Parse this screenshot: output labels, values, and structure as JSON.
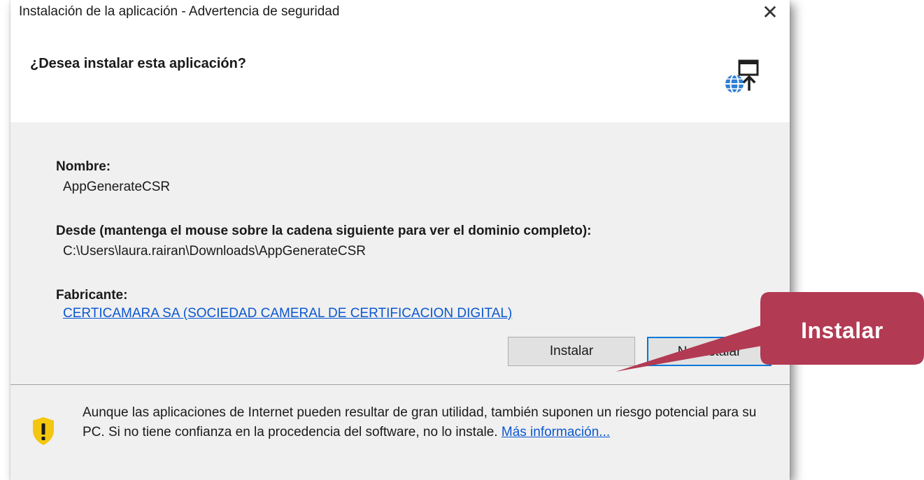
{
  "window": {
    "title": "Instalación de la aplicación - Advertencia de seguridad",
    "close_glyph": "✕"
  },
  "header": {
    "question": "¿Desea instalar esta aplicación?",
    "icon": "web-app-install-icon"
  },
  "fields": {
    "name_label": "Nombre:",
    "name_value": "AppGenerateCSR",
    "from_label": "Desde (mantenga el mouse sobre la cadena siguiente para ver el dominio completo):",
    "from_value": "C:\\Users\\laura.rairan\\Downloads\\AppGenerateCSR",
    "publisher_label": "Fabricante:",
    "publisher_value": "CERTICAMARA SA (SOCIEDAD CAMERAL DE CERTIFICACION DIGITAL)"
  },
  "buttons": {
    "install_label": "Instalar",
    "no_install_label": "No instalar"
  },
  "warning": {
    "icon": "shield-warning-icon",
    "text": "Aunque las aplicaciones de Internet pueden resultar de gran utilidad, también suponen un riesgo potencial para su PC. Si no tiene confianza en la procedencia del software, no lo instale.",
    "link_label": "Más información..."
  },
  "callout": {
    "label": "Instalar",
    "color": "#b23a53"
  },
  "colors": {
    "dialog_bg": "#f0f0f0",
    "link": "#0b57d0",
    "focus_border": "#0078d7",
    "warning_yellow": "#f4c60f"
  }
}
